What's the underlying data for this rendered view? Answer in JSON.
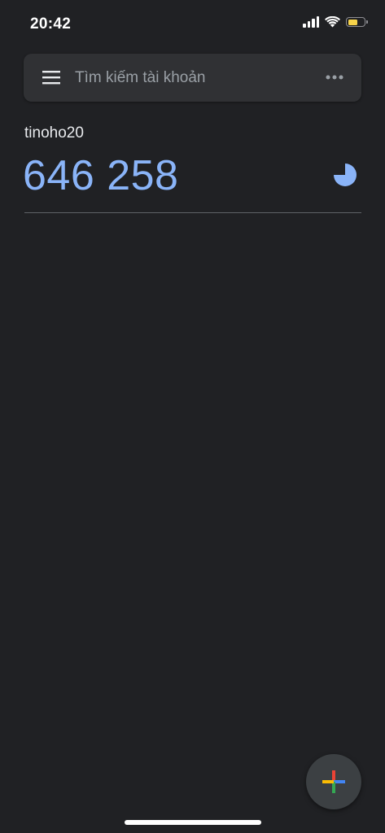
{
  "status_bar": {
    "time": "20:42",
    "battery_color": "#f7d34a"
  },
  "search": {
    "placeholder": "Tìm kiếm tài khoản",
    "menu_icon": "hamburger-menu-icon",
    "more_icon": "more-horizontal-icon"
  },
  "accounts": [
    {
      "name": "tinoho20",
      "code": "646 258",
      "timer_icon": "countdown-timer-icon"
    }
  ],
  "fab": {
    "icon": "add-plus-icon",
    "colors": [
      "#4285f4",
      "#ea4335",
      "#fbbc04",
      "#34a853"
    ]
  },
  "theme": {
    "background": "#202124",
    "code_color": "#8ab4f8"
  }
}
